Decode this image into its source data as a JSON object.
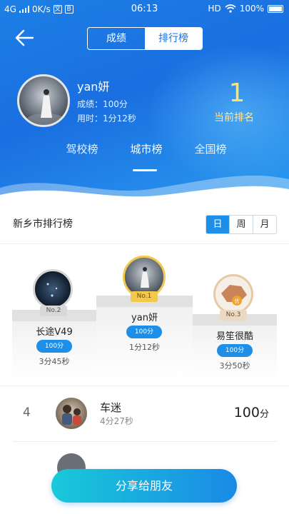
{
  "status_bar": {
    "network": "4G",
    "speed": "0K/s",
    "box1": "文",
    "box2": "B",
    "time": "06:13",
    "hd": "HD",
    "battery": "100%"
  },
  "header": {
    "tabs": [
      {
        "label": "成绩",
        "active": false
      },
      {
        "label": "排行榜",
        "active": true
      }
    ],
    "user": {
      "name": "yan妍",
      "score_line": "成绩：100分",
      "time_line": "用时：1分12秒"
    },
    "rank": {
      "value": "1",
      "label": "当前排名"
    },
    "scope_tabs": [
      {
        "label": "驾校榜",
        "active": false
      },
      {
        "label": "城市榜",
        "active": true
      },
      {
        "label": "全国榜",
        "active": false
      }
    ]
  },
  "leaderboard": {
    "title": "新乡市排行榜",
    "periods": [
      {
        "label": "日",
        "active": true
      },
      {
        "label": "周",
        "active": false
      },
      {
        "label": "月",
        "active": false
      }
    ],
    "podium": [
      {
        "place_badge": "No.2",
        "name": "长途V49",
        "score": "100分",
        "time": "3分45秒"
      },
      {
        "place_badge": "No.1",
        "name": "yan妍",
        "score": "100分",
        "time": "1分12秒"
      },
      {
        "place_badge": "No.3",
        "name": "易笙很酷",
        "score": "100分",
        "time": "3分50秒"
      }
    ],
    "list": [
      {
        "rank": "4",
        "name": "车迷",
        "time": "4分27秒",
        "score": "100",
        "unit": "分"
      }
    ]
  },
  "share_button": "分享给朋友",
  "colors": {
    "primary": "#1e8fe8",
    "gold": "#f2c94c",
    "rank_yellow": "#ffe36a"
  }
}
